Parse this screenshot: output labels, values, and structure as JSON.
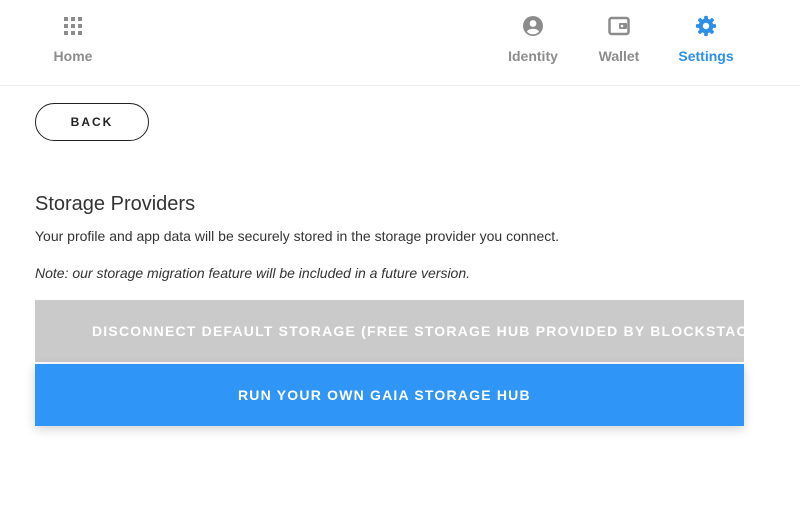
{
  "nav": {
    "home": {
      "label": "Home",
      "icon": "grid-icon"
    },
    "identity": {
      "label": "Identity",
      "icon": "user-circle-icon"
    },
    "wallet": {
      "label": "Wallet",
      "icon": "wallet-icon"
    },
    "settings": {
      "label": "Settings",
      "icon": "gear-icon",
      "active": true
    }
  },
  "back_label": "BACK",
  "storage": {
    "title": "Storage Providers",
    "description": "Your profile and app data will be securely stored in the storage provider you connect.",
    "note": "Note: our storage migration feature will be included in a future version.",
    "disconnect_label": "DISCONNECT DEFAULT STORAGE (FREE STORAGE HUB PROVIDED BY BLOCKSTACK)",
    "gaia_label": "RUN YOUR OWN GAIA STORAGE HUB"
  },
  "colors": {
    "accent": "#2b8fea",
    "primary_button": "#2f95f6",
    "disabled_button": "#cacaca",
    "nav_inactive": "#8c8c8c"
  }
}
